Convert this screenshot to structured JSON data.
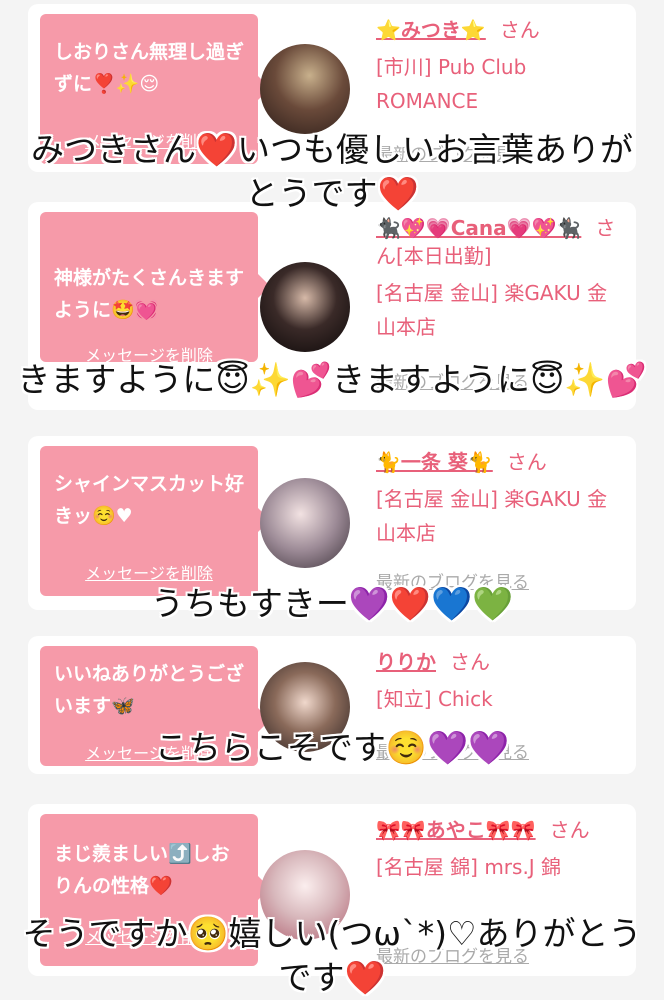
{
  "delete_label": "メッセージを削除",
  "blog_label": "最新のブログを見る",
  "san_label": "さん",
  "cards": [
    {
      "message": "しおりさん無理し過ぎずに❣️✨😌",
      "name": "⭐️みつき⭐️",
      "name_suffix": "",
      "shop": "[市川] Pub Club ROMANCE"
    },
    {
      "message": "神様がたくさんきますように🤩💓",
      "name": "🐈‍⬛💖💗Cana💗💖🐈‍⬛",
      "name_suffix": "[本日出勤]",
      "shop": "[名古屋 金山] 楽GAKU 金山本店"
    },
    {
      "message": "シャインマスカット好きッ☺️♥",
      "name": "🐈一条 葵🐈",
      "name_suffix": "",
      "shop": "[名古屋 金山] 楽GAKU 金山本店"
    },
    {
      "message": "いいねありがとうございます🦋",
      "name": "りりか",
      "name_suffix": "",
      "shop": "[知立] Chick"
    },
    {
      "message": "まじ羨ましい⤴️しおりんの性格❤️",
      "name": "🎀🎀あやこ🎀🎀",
      "name_suffix": "",
      "shop": "[名古屋 錦] mrs.J 錦"
    }
  ],
  "overlays": [
    "みつきさん❤️いつも優しいお言葉ありがとうです❤️",
    "きますように😇✨💕きますように😇✨💕",
    "うちもすきー💜❤️💙💚",
    "こちらこそです☺️💜💜",
    "そうですか🥺嬉しい(つω`*)♡ありがとうです❤️"
  ]
}
